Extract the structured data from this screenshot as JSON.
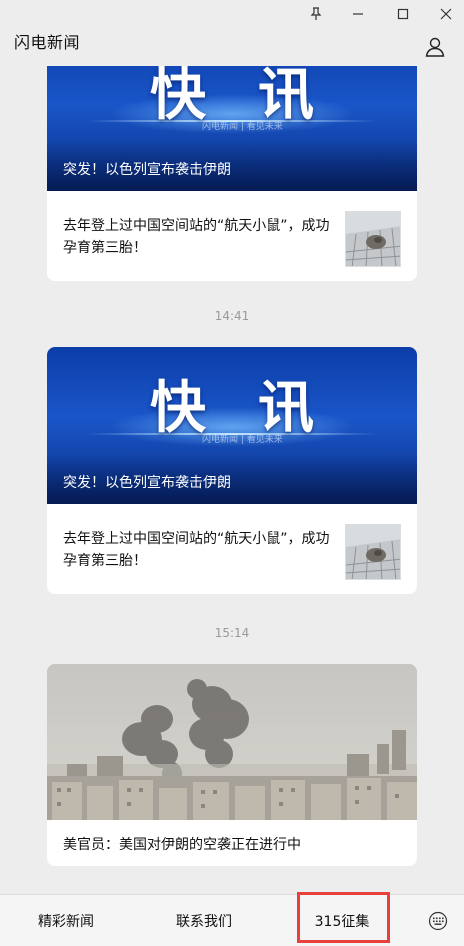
{
  "app": {
    "title": "闪电新闻"
  },
  "window_controls": [
    "pin-icon",
    "minimize-icon",
    "maximize-icon",
    "close-icon"
  ],
  "feed": {
    "card1": {
      "hero_text": "快讯",
      "hero_watermark": "闪电新闻 | 看见未来",
      "hero_caption": "突发！以色列宣布袭击伊朗",
      "sub_text": "去年登上过中国空间站的“航天小鼠”，成功孕育第三胎！"
    },
    "time1": "14:41",
    "card2": {
      "hero_text": "快讯",
      "hero_watermark": "闪电新闻 | 看见未来",
      "hero_caption": "突发！以色列宣布袭击伊朗",
      "sub_text": "去年登上过中国空间站的“航天小鼠”，成功孕育第三胎！"
    },
    "time2": "15:14",
    "card3": {
      "caption": "美官员：美国对伊朗的空袭正在进行中"
    }
  },
  "bottom_menu": {
    "item1": "精彩新闻",
    "item2": "联系我们",
    "item3": "315征集",
    "keyboard": "keyboard-icon"
  },
  "colors": {
    "background": "#ededed",
    "card": "#ffffff",
    "hero_blue": "#1a56c9",
    "highlight": "#e8403d",
    "timestamp": "#9a9a9a"
  }
}
